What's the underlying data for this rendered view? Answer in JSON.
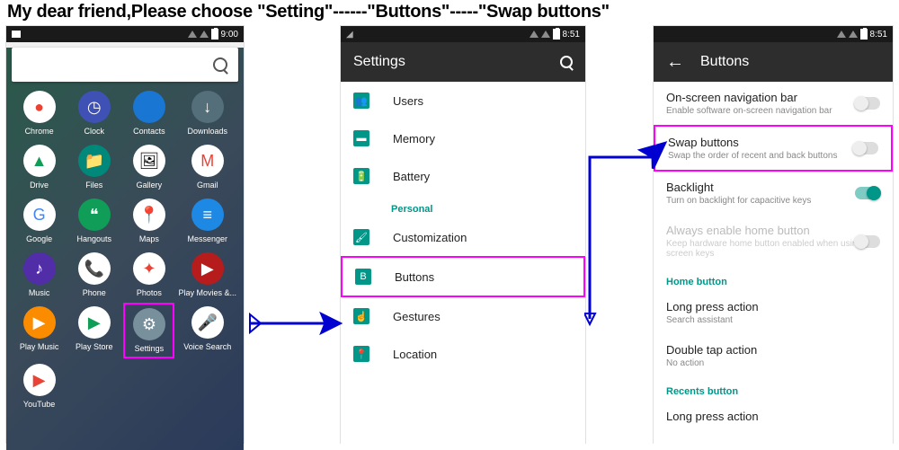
{
  "instruction": "My dear friend,Please choose \"Setting\"------\"Buttons\"-----\"Swap buttons\"",
  "status": {
    "time1": "9:00",
    "time2": "8:51",
    "time3": "8:51"
  },
  "apps": [
    {
      "label": "Chrome",
      "bg": "#fff",
      "emoji": "●",
      "fg": "#ea4335"
    },
    {
      "label": "Clock",
      "bg": "#3f51b5",
      "emoji": "◷",
      "fg": "#fff"
    },
    {
      "label": "Contacts",
      "bg": "#1976d2",
      "emoji": "👤",
      "fg": "#fff"
    },
    {
      "label": "Downloads",
      "bg": "#546e7a",
      "emoji": "↓",
      "fg": "#fff"
    },
    {
      "label": "Drive",
      "bg": "#fff",
      "emoji": "▲",
      "fg": "#0f9d58"
    },
    {
      "label": "Files",
      "bg": "#00897b",
      "emoji": "📁",
      "fg": "#fff"
    },
    {
      "label": "Gallery",
      "bg": "#fff",
      "emoji": "🖼",
      "fg": "#000"
    },
    {
      "label": "Gmail",
      "bg": "#fff",
      "emoji": "M",
      "fg": "#ea4335"
    },
    {
      "label": "Google",
      "bg": "#fff",
      "emoji": "G",
      "fg": "#4285f4"
    },
    {
      "label": "Hangouts",
      "bg": "#0f9d58",
      "emoji": "❝",
      "fg": "#fff"
    },
    {
      "label": "Maps",
      "bg": "#fff",
      "emoji": "📍",
      "fg": "#ea4335"
    },
    {
      "label": "Messenger",
      "bg": "#1e88e5",
      "emoji": "≡",
      "fg": "#fff"
    },
    {
      "label": "Music",
      "bg": "#512da8",
      "emoji": "♪",
      "fg": "#fff"
    },
    {
      "label": "Phone",
      "bg": "#fff",
      "emoji": "📞",
      "fg": "#1976d2"
    },
    {
      "label": "Photos",
      "bg": "#fff",
      "emoji": "✦",
      "fg": "#ea4335"
    },
    {
      "label": "Play Movies &...",
      "bg": "#b71c1c",
      "emoji": "▶",
      "fg": "#fff"
    },
    {
      "label": "Play Music",
      "bg": "#fb8c00",
      "emoji": "▶",
      "fg": "#fff"
    },
    {
      "label": "Play Store",
      "bg": "#fff",
      "emoji": "▶",
      "fg": "#0f9d58"
    },
    {
      "label": "Settings",
      "bg": "#78909c",
      "emoji": "⚙",
      "fg": "#fff"
    },
    {
      "label": "Voice Search",
      "bg": "#fff",
      "emoji": "🎤",
      "fg": "#4285f4"
    },
    {
      "label": "YouTube",
      "bg": "#fff",
      "emoji": "▶",
      "fg": "#ea4335"
    }
  ],
  "screen2": {
    "title": "Settings",
    "items": [
      {
        "icon": "👥",
        "iconcolor": "#009688",
        "label": "Users"
      },
      {
        "icon": "▬",
        "iconcolor": "#009688",
        "label": "Memory"
      },
      {
        "icon": "🔋",
        "iconcolor": "#009688",
        "label": "Battery"
      }
    ],
    "section_personal": "Personal",
    "personal": [
      {
        "icon": "🖌",
        "iconcolor": "#009688",
        "label": "Customization"
      },
      {
        "icon": "B",
        "iconcolor": "#009688",
        "label": "Buttons",
        "hilite": true
      },
      {
        "icon": "☝",
        "iconcolor": "#009688",
        "label": "Gestures"
      },
      {
        "icon": "📍",
        "iconcolor": "#009688",
        "label": "Location"
      }
    ]
  },
  "screen3": {
    "title": "Buttons",
    "rows": [
      {
        "label": "On-screen navigation bar",
        "sub": "Enable software on-screen navigation bar",
        "toggle": "off"
      },
      {
        "label": "Swap buttons",
        "sub": "Swap the order of recent and back buttons",
        "toggle": "off",
        "hilite": true
      },
      {
        "label": "Backlight",
        "sub": "Turn on backlight for capacitive keys",
        "toggle": "on"
      },
      {
        "label": "Always enable home button",
        "sub": "Keep hardware home button enabled when using on-screen keys",
        "toggle": "off",
        "disabled": true
      }
    ],
    "section_home": "Home button",
    "home": [
      {
        "label": "Long press action",
        "sub": "Search assistant"
      },
      {
        "label": "Double tap action",
        "sub": "No action"
      }
    ],
    "section_recents": "Recents button",
    "recents_row": "Long press action"
  }
}
